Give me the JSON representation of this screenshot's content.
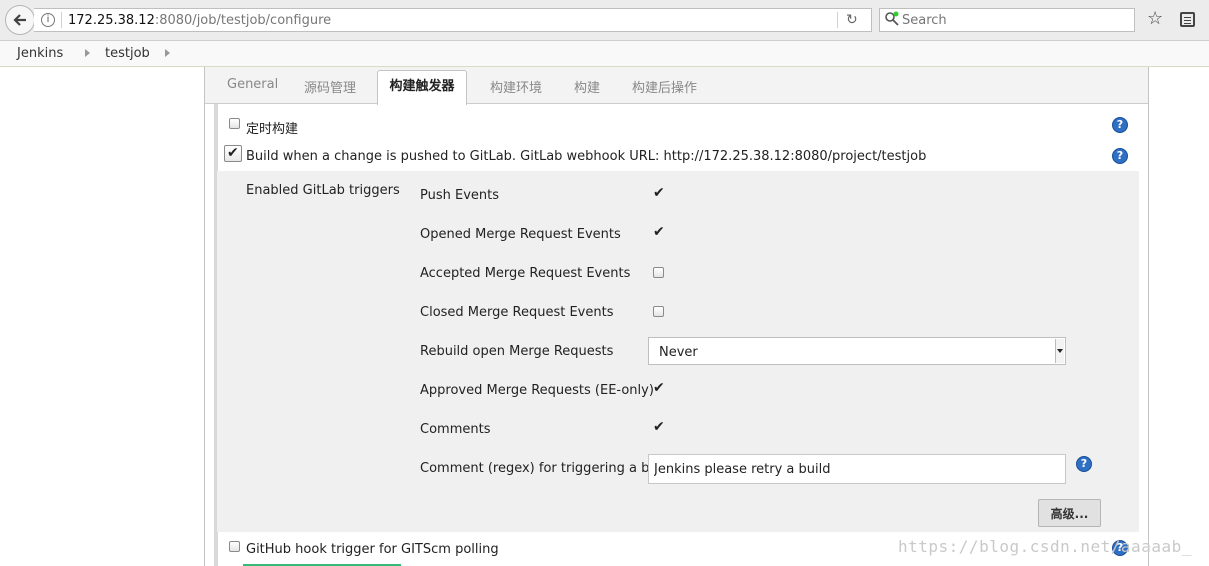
{
  "browser": {
    "url_host": "172.25.38.12",
    "url_path": ":8080/job/testjob/configure",
    "search_placeholder": "Search"
  },
  "breadcrumb": {
    "items": [
      "Jenkins",
      "testjob"
    ]
  },
  "tabs": {
    "general": "General",
    "scm": "源码管理",
    "triggers": "构建触发器",
    "environment": "构建环境",
    "build": "构建",
    "post_build": "构建后操作",
    "active": "triggers"
  },
  "triggers": {
    "timed_build": {
      "label": "定时构建",
      "checked": false
    },
    "gitlab_push": {
      "label": "Build when a change is pushed to GitLab. GitLab webhook URL: http://172.25.38.12:8080/project/testjob",
      "checked": true
    },
    "enabled_label": "Enabled GitLab triggers",
    "options": [
      {
        "label": "Push Events",
        "checked": true
      },
      {
        "label": "Opened Merge Request Events",
        "checked": true
      },
      {
        "label": "Accepted Merge Request Events",
        "checked": false
      },
      {
        "label": "Closed Merge Request Events",
        "checked": false
      }
    ],
    "rebuild": {
      "label": "Rebuild open Merge Requests",
      "value": "Never"
    },
    "approved": {
      "label": "Approved Merge Requests (EE-only)",
      "checked": true
    },
    "comments": {
      "label": "Comments",
      "checked": true
    },
    "comment_regex": {
      "label": "Comment (regex) for triggering a build",
      "value": "Jenkins please retry a build"
    },
    "advanced_button": "高级...",
    "github_hook": {
      "label": "GitHub hook trigger for GITScm polling",
      "checked": false
    }
  },
  "watermark": "https://blog.csdn.net/aaaaab_",
  "help_glyph": "?",
  "check_glyph": "✔",
  "icons": {
    "back": "back-arrow-icon",
    "info": "info-icon",
    "reload": "reload-icon",
    "search": "search-icon",
    "star": "star-icon",
    "reader": "reader-view-icon",
    "help": "help-icon"
  }
}
